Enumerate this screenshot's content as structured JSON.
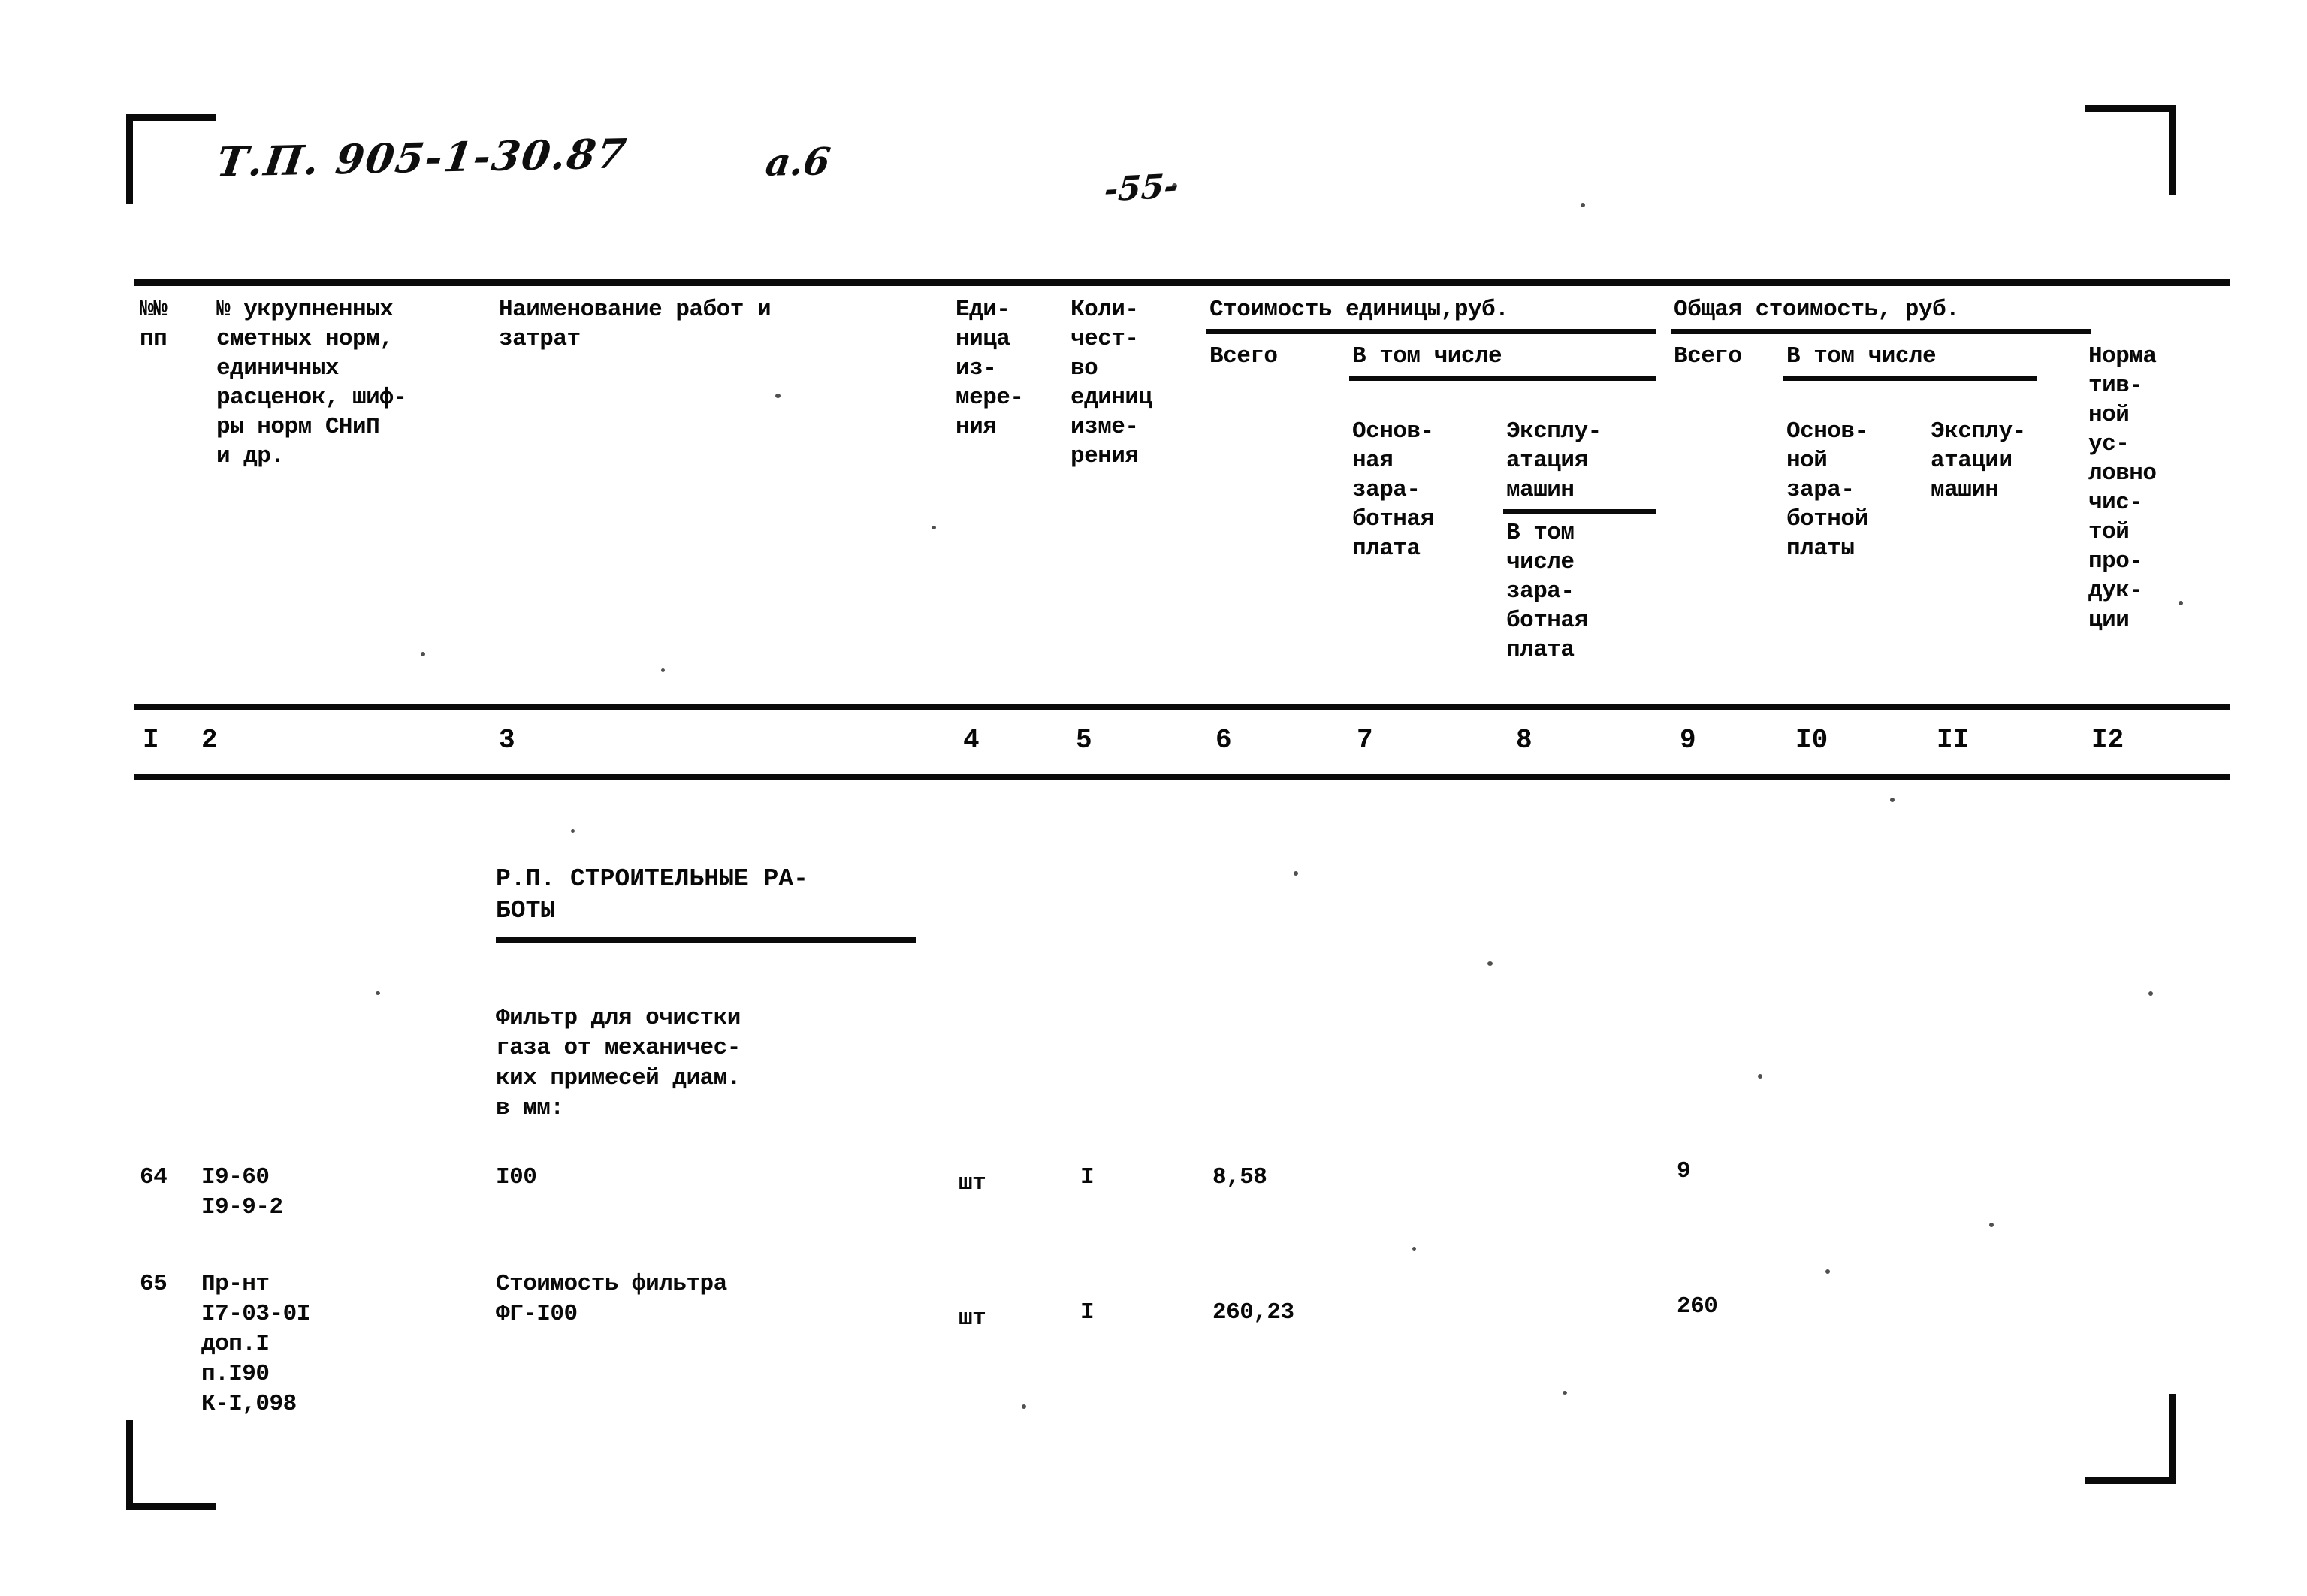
{
  "handwritten": {
    "project_code": "Т.П.  905-1-30.87",
    "sheet_label": "а.6",
    "page_number": "-55-"
  },
  "table": {
    "headers": {
      "col1": "№№\nпп",
      "col2": "№ укрупненных\nсметных норм,\nединичных\nрасценок, шиф-\nры норм СНиП\nи др.",
      "col3": "Наименование работ и\nзатрат",
      "col4": "Еди-\nница\nиз-\nмере-\nния",
      "col5": "Коли-\nчест-\nво\nединиц\nизме-\nрения",
      "group_unit_cost": "Стоимость единицы,руб.",
      "col6": "Всего",
      "sub_incl_unit": "В том числе",
      "col7": "Основ-\nная\nзара-\nботная\nплата",
      "col8_machines": "Эксплу-\nатация\nмашин",
      "col8_incl": "В том\nчисле\nзара-\nботная\nплата",
      "group_total_cost": "Общая стоимость, руб.",
      "col9": "Всего",
      "sub_incl_total": "В том числе",
      "col10": "Основ-\nной\nзара-\nботной\nплаты",
      "col11": "Эксплу-\nатации\nмашин",
      "col12": "Норма\nтив-\nной\nус-\nловно\nчис-\nтой\nпро-\nдук-\nции"
    },
    "column_numbers": [
      "I",
      "2",
      "3",
      "4",
      "5",
      "6",
      "7",
      "8",
      "9",
      "I0",
      "II",
      "I2"
    ],
    "section_heading": "Р.П. СТРОИТЕЛЬНЫЕ РА-\n     БОТЫ",
    "group_description": "Фильтр для очистки\nгаза от механичес-\nких примесей диам.\nв мм:",
    "rows": [
      {
        "no": "64",
        "norm_code": "I9-60\n I9-9-2",
        "name": "I00",
        "unit": "шт",
        "quantity": "I",
        "unit_total": "8,58",
        "unit_wage": "",
        "unit_machines": "",
        "total": "9",
        "total_wage": "",
        "total_machines": "",
        "normative": ""
      },
      {
        "no": "65",
        "norm_code": "Пр-нт\nI7-03-0I\nдоп.I\nп.I90\nК-I,098",
        "name": "Стоимость фильтра\nФГ-I00",
        "unit": "шт",
        "quantity": "I",
        "unit_total": "260,23",
        "unit_wage": "",
        "unit_machines": "",
        "total": "260",
        "total_wage": "",
        "total_machines": "",
        "normative": ""
      }
    ]
  }
}
